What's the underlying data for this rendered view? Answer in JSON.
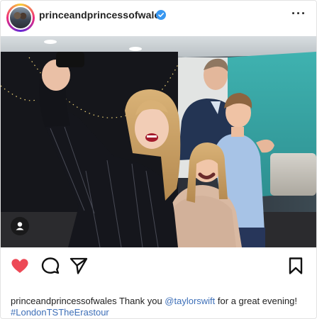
{
  "post": {
    "username": "princeandprincessofwales",
    "verified": true,
    "more_icon": "ellipsis-icon",
    "more_label": "···"
  },
  "photo": {
    "description_icon": "person-tag-icon"
  },
  "actions": {
    "like_icon": "heart-filled-icon",
    "comment_icon": "comment-icon",
    "share_icon": "send-icon",
    "save_icon": "bookmark-icon",
    "like_color": "#ed4956"
  },
  "caption": {
    "username": "princeandprincessofwales",
    "text_1": " Thank you ",
    "mention": "@taylorswift",
    "text_2": " for a great evening! ",
    "hashtag": "#LondonTSTheErastour"
  },
  "colors": {
    "link": "#3d6fb8",
    "verified": "#3897f0"
  }
}
